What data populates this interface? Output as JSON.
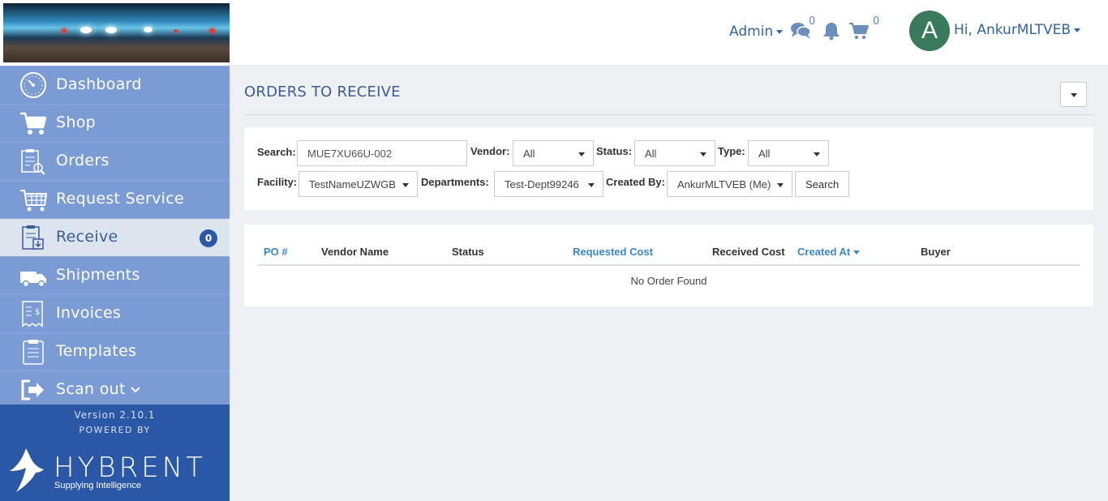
{
  "sidebar": {
    "items": [
      {
        "label": "Dashboard",
        "icon": "dashboard-icon"
      },
      {
        "label": "Shop",
        "icon": "cart-icon"
      },
      {
        "label": "Orders",
        "icon": "orders-icon"
      },
      {
        "label": "Request Service",
        "icon": "request-service-icon"
      },
      {
        "label": "Receive",
        "icon": "receive-icon",
        "badge": "0",
        "active": true
      },
      {
        "label": "Shipments",
        "icon": "truck-icon"
      },
      {
        "label": "Invoices",
        "icon": "invoice-icon"
      },
      {
        "label": "Templates",
        "icon": "templates-icon"
      },
      {
        "label": "Scan out",
        "icon": "scan-out-icon"
      }
    ],
    "version": "Version 2.10.1",
    "powered_by": "POWERED BY",
    "brand": {
      "name": "HYBRENT",
      "tagline": "Supplying Intelligence"
    }
  },
  "header": {
    "admin_label": "Admin",
    "messages_count": "0",
    "cart_count": "0",
    "avatar_letter": "A",
    "greeting": "Hi, AnkurMLTVEB"
  },
  "page": {
    "title": "ORDERS TO RECEIVE"
  },
  "filters": {
    "search_label": "Search:",
    "search_value": "MUE7XU66U-002",
    "vendor_label": "Vendor:",
    "vendor_value": "All",
    "status_label": "Status:",
    "status_value": "All",
    "type_label": "Type:",
    "type_value": "All",
    "facility_label": "Facility:",
    "facility_value": "TestNameUZWGB",
    "departments_label": "Departments:",
    "departments_value": "Test-Dept99246",
    "created_by_label": "Created By:",
    "created_by_value": "AnkurMLTVEB (Me)",
    "search_button": "Search"
  },
  "table": {
    "columns": [
      "PO #",
      "Vendor Name",
      "Status",
      "Requested Cost",
      "Received Cost",
      "Created At",
      "Buyer"
    ],
    "empty_text": "No Order Found"
  },
  "colors": {
    "sidebar_bg": "#2b58a6",
    "nav_item_bg": "#7a9bd3",
    "nav_active_bg": "#dce4ee",
    "accent": "#3c85c6",
    "title_color": "#3b5d95"
  }
}
